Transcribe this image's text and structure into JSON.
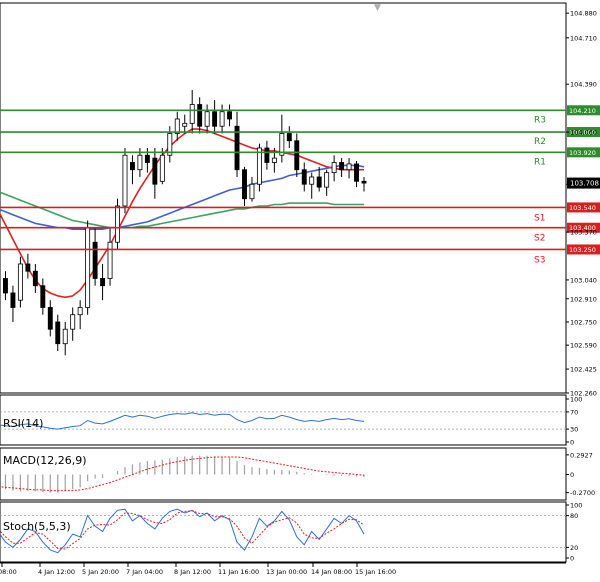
{
  "chart_data": {
    "type": "candlestick",
    "price_axis": {
      "ticks": [
        "104.880",
        "104.710",
        "104.390",
        "104.060",
        "103.700",
        "103.370",
        "103.040",
        "102.910",
        "102.750",
        "102.590",
        "102.425",
        "102.260"
      ],
      "range": [
        102.26,
        104.95
      ]
    },
    "x_ticks": [
      "08:00",
      "4 Jan 12:00",
      "5 Jan 20:00",
      "7 Jan 04:00",
      "8 Jan 12:00",
      "11 Jan 16:00",
      "13 Jan 00:00",
      "14 Jan 08:00",
      "15 Jan 16:00"
    ],
    "current_price": "103.708",
    "levels": [
      {
        "name": "R3",
        "value": 104.21,
        "value_label": "104.210",
        "type": "resistance",
        "color": "#2e8b2e"
      },
      {
        "name": "R2",
        "value": 104.06,
        "value_label": "104.060",
        "type": "resistance",
        "color": "#2e8b2e"
      },
      {
        "name": "R1",
        "value": 103.92,
        "value_label": "103.920",
        "type": "resistance",
        "color": "#2e8b2e"
      },
      {
        "name": "S1",
        "value": 103.54,
        "value_label": "103.540",
        "type": "support",
        "color": "#d62020"
      },
      {
        "name": "S2",
        "value": 103.4,
        "value_label": "103.400",
        "type": "support",
        "color": "#d62020"
      },
      {
        "name": "S3",
        "value": 103.25,
        "value_label": "103.250",
        "type": "support",
        "color": "#d62020"
      }
    ],
    "candles": [
      {
        "o": 103.3,
        "h": 103.35,
        "l": 102.95,
        "c": 103.05
      },
      {
        "o": 103.05,
        "h": 103.1,
        "l": 102.9,
        "c": 102.95
      },
      {
        "o": 102.95,
        "h": 103.0,
        "l": 102.75,
        "c": 102.85
      },
      {
        "o": 102.9,
        "h": 103.2,
        "l": 102.85,
        "c": 103.15
      },
      {
        "o": 103.15,
        "h": 103.22,
        "l": 103.05,
        "c": 103.1
      },
      {
        "o": 103.1,
        "h": 103.15,
        "l": 102.95,
        "c": 103.0
      },
      {
        "o": 103.0,
        "h": 103.05,
        "l": 102.8,
        "c": 102.85
      },
      {
        "o": 102.85,
        "h": 102.9,
        "l": 102.65,
        "c": 102.7
      },
      {
        "o": 102.75,
        "h": 102.8,
        "l": 102.55,
        "c": 102.6
      },
      {
        "o": 102.6,
        "h": 102.75,
        "l": 102.52,
        "c": 102.7
      },
      {
        "o": 102.7,
        "h": 102.85,
        "l": 102.62,
        "c": 102.8
      },
      {
        "o": 102.8,
        "h": 102.9,
        "l": 102.7,
        "c": 102.85
      },
      {
        "o": 102.85,
        "h": 103.45,
        "l": 102.8,
        "c": 103.4
      },
      {
        "o": 103.3,
        "h": 103.4,
        "l": 103.0,
        "c": 103.05
      },
      {
        "o": 103.05,
        "h": 103.15,
        "l": 102.9,
        "c": 103.0
      },
      {
        "o": 103.05,
        "h": 103.4,
        "l": 103.0,
        "c": 103.3
      },
      {
        "o": 103.3,
        "h": 103.6,
        "l": 103.25,
        "c": 103.55
      },
      {
        "o": 103.55,
        "h": 103.95,
        "l": 103.5,
        "c": 103.9
      },
      {
        "o": 103.85,
        "h": 103.9,
        "l": 103.7,
        "c": 103.8
      },
      {
        "o": 103.8,
        "h": 103.95,
        "l": 103.75,
        "c": 103.9
      },
      {
        "o": 103.9,
        "h": 103.95,
        "l": 103.78,
        "c": 103.85
      },
      {
        "o": 103.88,
        "h": 103.95,
        "l": 103.6,
        "c": 103.7
      },
      {
        "o": 103.72,
        "h": 103.95,
        "l": 103.7,
        "c": 103.9
      },
      {
        "o": 103.9,
        "h": 104.1,
        "l": 103.85,
        "c": 104.05
      },
      {
        "o": 104.05,
        "h": 104.2,
        "l": 104.0,
        "c": 104.15
      },
      {
        "o": 104.1,
        "h": 104.18,
        "l": 104.05,
        "c": 104.12
      },
      {
        "o": 104.12,
        "h": 104.35,
        "l": 104.05,
        "c": 104.25
      },
      {
        "o": 104.25,
        "h": 104.3,
        "l": 104.05,
        "c": 104.1
      },
      {
        "o": 104.1,
        "h": 104.25,
        "l": 104.05,
        "c": 104.2
      },
      {
        "o": 104.2,
        "h": 104.28,
        "l": 104.05,
        "c": 104.1
      },
      {
        "o": 104.1,
        "h": 104.25,
        "l": 104.05,
        "c": 104.2
      },
      {
        "o": 104.2,
        "h": 104.25,
        "l": 104.1,
        "c": 104.15
      },
      {
        "o": 104.1,
        "h": 104.2,
        "l": 103.75,
        "c": 103.8
      },
      {
        "o": 103.8,
        "h": 103.82,
        "l": 103.55,
        "c": 103.6
      },
      {
        "o": 103.6,
        "h": 103.75,
        "l": 103.58,
        "c": 103.7
      },
      {
        "o": 103.7,
        "h": 103.98,
        "l": 103.65,
        "c": 103.95
      },
      {
        "o": 103.95,
        "h": 104.0,
        "l": 103.8,
        "c": 103.85
      },
      {
        "o": 103.85,
        "h": 103.95,
        "l": 103.78,
        "c": 103.88
      },
      {
        "o": 103.9,
        "h": 104.18,
        "l": 103.85,
        "c": 104.05
      },
      {
        "o": 104.05,
        "h": 104.1,
        "l": 103.95,
        "c": 104.0
      },
      {
        "o": 104.0,
        "h": 104.05,
        "l": 103.75,
        "c": 103.8
      },
      {
        "o": 103.8,
        "h": 103.85,
        "l": 103.65,
        "c": 103.7
      },
      {
        "o": 103.7,
        "h": 103.78,
        "l": 103.6,
        "c": 103.75
      },
      {
        "o": 103.75,
        "h": 103.82,
        "l": 103.65,
        "c": 103.68
      },
      {
        "o": 103.68,
        "h": 103.8,
        "l": 103.62,
        "c": 103.78
      },
      {
        "o": 103.78,
        "h": 103.9,
        "l": 103.72,
        "c": 103.85
      },
      {
        "o": 103.85,
        "h": 103.88,
        "l": 103.75,
        "c": 103.8
      },
      {
        "o": 103.8,
        "h": 103.88,
        "l": 103.74,
        "c": 103.84
      },
      {
        "o": 103.84,
        "h": 103.86,
        "l": 103.68,
        "c": 103.72
      },
      {
        "o": 103.72,
        "h": 103.75,
        "l": 103.65,
        "c": 103.708
      }
    ],
    "moving_averages": [
      {
        "color": "#e02020",
        "values": [
          103.52,
          103.42,
          103.32,
          103.22,
          103.12,
          103.04,
          102.98,
          102.95,
          102.93,
          102.92,
          102.93,
          102.97,
          103.04,
          103.12,
          103.2,
          103.28,
          103.38,
          103.48,
          103.58,
          103.67,
          103.75,
          103.83,
          103.9,
          103.96,
          104.01,
          104.05,
          104.08,
          104.08,
          104.07,
          104.05,
          104.03,
          104.01,
          103.99,
          103.97,
          103.95,
          103.94,
          103.93,
          103.93,
          103.92,
          103.91,
          103.9,
          103.88,
          103.86,
          103.84,
          103.82,
          103.81,
          103.8,
          103.8,
          103.8,
          103.8
        ]
      },
      {
        "color": "#4060d0",
        "values": [
          103.53,
          103.51,
          103.49,
          103.47,
          103.45,
          103.43,
          103.42,
          103.41,
          103.4,
          103.4,
          103.39,
          103.39,
          103.39,
          103.39,
          103.39,
          103.4,
          103.4,
          103.41,
          103.42,
          103.43,
          103.44,
          103.46,
          103.48,
          103.5,
          103.52,
          103.54,
          103.56,
          103.58,
          103.6,
          103.62,
          103.64,
          103.66,
          103.67,
          103.68,
          103.7,
          103.71,
          103.72,
          103.73,
          103.74,
          103.76,
          103.77,
          103.78,
          103.79,
          103.8,
          103.81,
          103.82,
          103.83,
          103.83,
          103.83,
          103.82
        ]
      },
      {
        "color": "#40a060",
        "values": [
          103.65,
          103.63,
          103.61,
          103.59,
          103.57,
          103.55,
          103.53,
          103.51,
          103.49,
          103.47,
          103.45,
          103.44,
          103.43,
          103.42,
          103.41,
          103.4,
          103.4,
          103.4,
          103.4,
          103.41,
          103.41,
          103.42,
          103.43,
          103.44,
          103.45,
          103.46,
          103.47,
          103.48,
          103.49,
          103.5,
          103.51,
          103.52,
          103.53,
          103.53,
          103.54,
          103.55,
          103.55,
          103.56,
          103.56,
          103.57,
          103.57,
          103.57,
          103.57,
          103.57,
          103.57,
          103.56,
          103.56,
          103.56,
          103.56,
          103.56
        ]
      }
    ],
    "indicators": [
      {
        "label": "RSI(14)",
        "ticks": [
          "100",
          "70",
          "30",
          "0"
        ],
        "levels": [
          70,
          30
        ],
        "range": [
          0,
          100
        ],
        "line_color": "#3070d0",
        "values": [
          40,
          38,
          36,
          40,
          42,
          38,
          35,
          32,
          30,
          33,
          36,
          38,
          50,
          44,
          42,
          48,
          55,
          62,
          58,
          62,
          60,
          55,
          60,
          64,
          66,
          65,
          68,
          64,
          66,
          62,
          65,
          64,
          52,
          45,
          50,
          58,
          54,
          55,
          62,
          58,
          52,
          48,
          50,
          48,
          52,
          55,
          52,
          54,
          50,
          48
        ]
      },
      {
        "label": "MACD(12,26,9)",
        "ticks": [
          "0.2927",
          "0",
          "-0.2700"
        ],
        "range": [
          -0.35,
          0.35
        ],
        "hist_color": "#a0a0a0",
        "signal_color": "#e02020",
        "hist": [
          -0.2,
          -0.22,
          -0.24,
          -0.25,
          -0.25,
          -0.25,
          -0.26,
          -0.27,
          -0.27,
          -0.25,
          -0.22,
          -0.19,
          -0.1,
          -0.06,
          -0.05,
          0.0,
          0.05,
          0.11,
          0.15,
          0.18,
          0.2,
          0.21,
          0.22,
          0.24,
          0.26,
          0.27,
          0.28,
          0.28,
          0.28,
          0.27,
          0.26,
          0.25,
          0.2,
          0.14,
          0.11,
          0.1,
          0.08,
          0.07,
          0.07,
          0.06,
          0.04,
          0.02,
          0.01,
          0.0,
          -0.01,
          -0.02,
          -0.02,
          -0.02,
          -0.03,
          -0.04
        ],
        "signal": [
          -0.18,
          -0.19,
          -0.2,
          -0.21,
          -0.22,
          -0.23,
          -0.23,
          -0.24,
          -0.24,
          -0.24,
          -0.24,
          -0.23,
          -0.21,
          -0.18,
          -0.15,
          -0.12,
          -0.08,
          -0.04,
          0.0,
          0.04,
          0.08,
          0.11,
          0.14,
          0.17,
          0.19,
          0.21,
          0.23,
          0.24,
          0.25,
          0.26,
          0.26,
          0.26,
          0.26,
          0.25,
          0.23,
          0.21,
          0.19,
          0.17,
          0.15,
          0.13,
          0.11,
          0.09,
          0.07,
          0.05,
          0.04,
          0.03,
          0.02,
          0.01,
          0.0,
          -0.01
        ]
      },
      {
        "label": "Stoch(5,5,3)",
        "ticks": [
          "100",
          "80",
          "20",
          "0"
        ],
        "levels": [
          80,
          20
        ],
        "range": [
          0,
          100
        ],
        "k_color": "#3070d0",
        "d_color": "#e02020",
        "k": [
          50,
          30,
          20,
          35,
          55,
          50,
          30,
          15,
          10,
          25,
          45,
          40,
          80,
          60,
          50,
          75,
          90,
          92,
          70,
          80,
          65,
          55,
          75,
          88,
          92,
          85,
          90,
          78,
          85,
          70,
          80,
          72,
          30,
          15,
          40,
          75,
          60,
          70,
          88,
          72,
          40,
          25,
          50,
          35,
          55,
          75,
          65,
          80,
          70,
          45
        ],
        "d": [
          55,
          40,
          28,
          28,
          38,
          48,
          45,
          32,
          18,
          17,
          27,
          37,
          55,
          62,
          63,
          62,
          72,
          85,
          84,
          80,
          72,
          67,
          65,
          72,
          85,
          88,
          89,
          84,
          84,
          78,
          78,
          74,
          60,
          38,
          28,
          43,
          58,
          68,
          72,
          76,
          66,
          45,
          38,
          37,
          47,
          55,
          65,
          73,
          72,
          62
        ]
      }
    ]
  }
}
